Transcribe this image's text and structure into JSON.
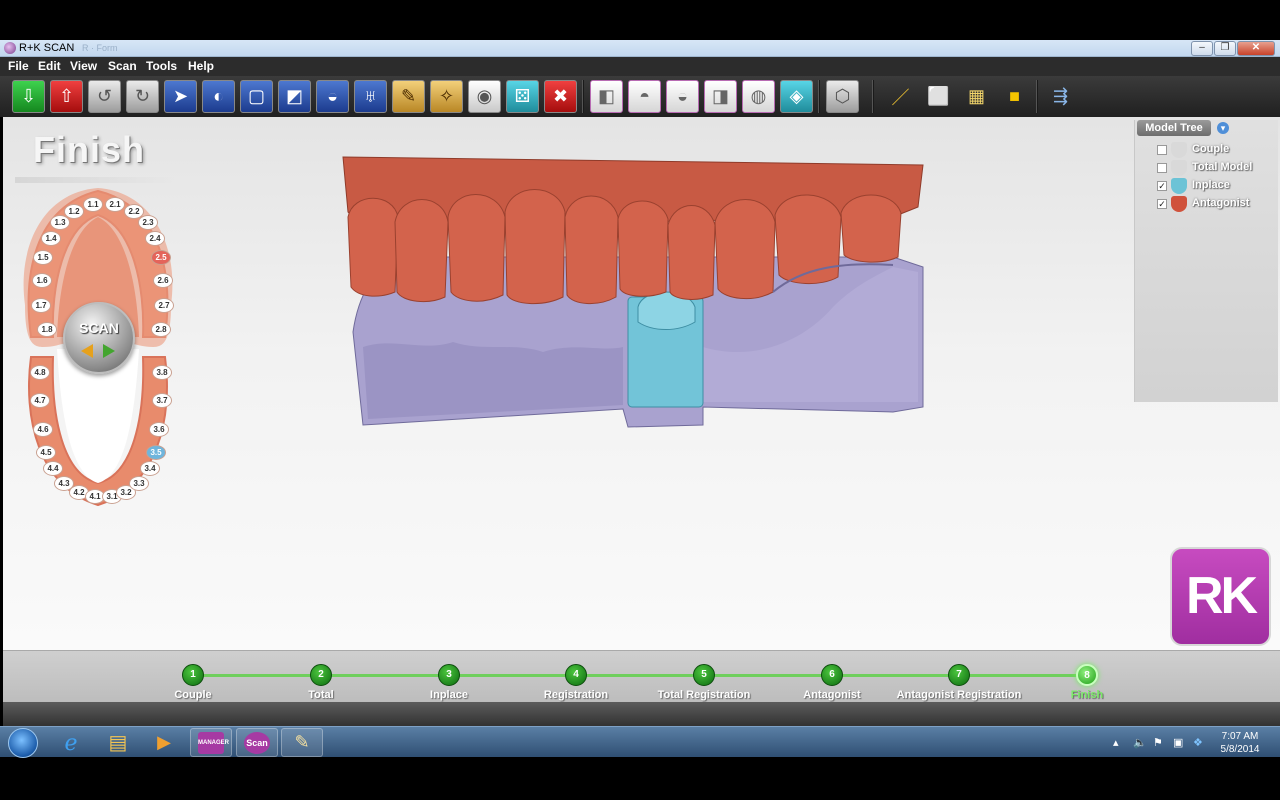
{
  "window": {
    "title": "R+K SCAN",
    "ghost_text": "R · Form"
  },
  "menu": [
    "File",
    "Edit",
    "View",
    "Scan",
    "Tools",
    "Help"
  ],
  "toolbar_icons": [
    "import-icon",
    "export-icon",
    "rotate-left-icon",
    "rotate-right-icon",
    "select-icon",
    "lasso-icon",
    "rectangle-select-icon",
    "plane-cut-icon",
    "surface-icon",
    "tooth-icon",
    "camera-icon",
    "compass-icon",
    "snapshot-icon",
    "dice-icon",
    "delete-icon",
    "view-left-icon",
    "view-top-icon",
    "view-bottom-icon",
    "view-right-icon",
    "view-front-icon",
    "view-occlusal-icon",
    "view-default-icon",
    "ruler-icon",
    "cube-icon",
    "mesh-cube-icon",
    "solid-cube-icon",
    "export-model-icon"
  ],
  "workspace": {
    "step_title": "Finish"
  },
  "tooth_chart": {
    "scan_label": "SCAN",
    "teeth": [
      {
        "id": "1.8",
        "state": "normal"
      },
      {
        "id": "1.7",
        "state": "normal"
      },
      {
        "id": "1.6",
        "state": "normal"
      },
      {
        "id": "1.5",
        "state": "normal"
      },
      {
        "id": "1.4",
        "state": "normal"
      },
      {
        "id": "1.3",
        "state": "normal"
      },
      {
        "id": "1.2",
        "state": "normal"
      },
      {
        "id": "1.1",
        "state": "normal"
      },
      {
        "id": "2.1",
        "state": "normal"
      },
      {
        "id": "2.2",
        "state": "normal"
      },
      {
        "id": "2.3",
        "state": "normal"
      },
      {
        "id": "2.4",
        "state": "normal"
      },
      {
        "id": "2.5",
        "state": "antagonist"
      },
      {
        "id": "2.6",
        "state": "normal"
      },
      {
        "id": "2.7",
        "state": "normal"
      },
      {
        "id": "2.8",
        "state": "normal"
      },
      {
        "id": "4.8",
        "state": "normal"
      },
      {
        "id": "4.7",
        "state": "normal"
      },
      {
        "id": "4.6",
        "state": "normal"
      },
      {
        "id": "4.5",
        "state": "normal"
      },
      {
        "id": "4.4",
        "state": "normal"
      },
      {
        "id": "4.3",
        "state": "normal"
      },
      {
        "id": "4.2",
        "state": "normal"
      },
      {
        "id": "4.1",
        "state": "normal"
      },
      {
        "id": "3.1",
        "state": "normal"
      },
      {
        "id": "3.2",
        "state": "normal"
      },
      {
        "id": "3.3",
        "state": "normal"
      },
      {
        "id": "3.4",
        "state": "normal"
      },
      {
        "id": "3.5",
        "state": "inplace"
      },
      {
        "id": "3.6",
        "state": "normal"
      },
      {
        "id": "3.7",
        "state": "normal"
      },
      {
        "id": "3.8",
        "state": "normal"
      }
    ]
  },
  "model_tree": {
    "header": "Model Tree",
    "items": [
      {
        "label": "Couple",
        "checked": false,
        "color": "#d9d9d9"
      },
      {
        "label": "Total Model",
        "checked": false,
        "color": "#d9d9d9"
      },
      {
        "label": "Inplace",
        "checked": true,
        "color": "#6cc3d6"
      },
      {
        "label": "Antagonist",
        "checked": true,
        "color": "#d0523c"
      }
    ]
  },
  "logo": {
    "text": "RK"
  },
  "steps": [
    {
      "num": "1",
      "label": "Couple"
    },
    {
      "num": "2",
      "label": "Total"
    },
    {
      "num": "3",
      "label": "Inplace"
    },
    {
      "num": "4",
      "label": "Registration"
    },
    {
      "num": "5",
      "label": "Total Registration"
    },
    {
      "num": "6",
      "label": "Antagonist"
    },
    {
      "num": "7",
      "label": "Antagonist Registration"
    },
    {
      "num": "8",
      "label": "Finish"
    }
  ],
  "active_step": 8,
  "taskbar": {
    "apps": [
      "ie-icon",
      "folder-icon",
      "media-player-icon",
      "rk-manager-icon",
      "rk-scan-icon",
      "paint-icon"
    ],
    "manager_label": "MANAGER",
    "scan_label": "Scan",
    "time": "7:07 AM",
    "date": "5/8/2014"
  },
  "colors": {
    "antagonist": "#d0523c",
    "gum": "#a9a2cf",
    "inplace": "#72c4d8",
    "accent_green": "#2fb52a",
    "brand_purple": "#b33fb0"
  }
}
